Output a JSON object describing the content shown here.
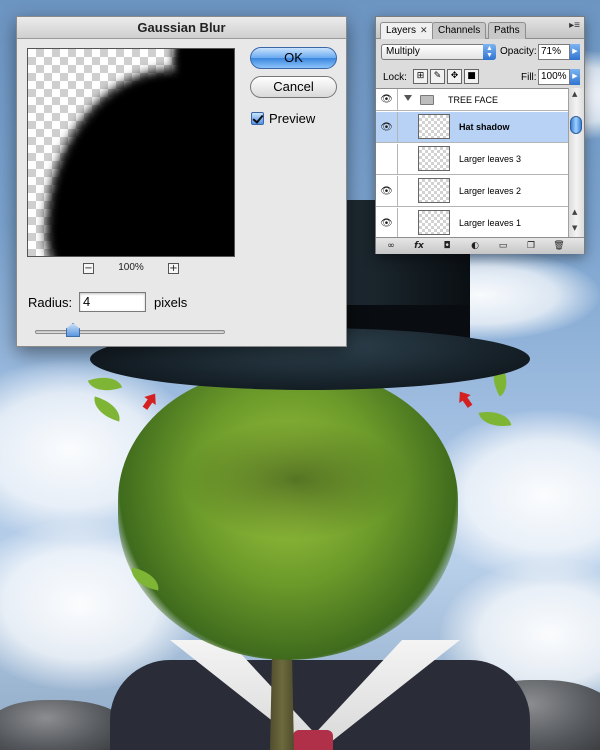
{
  "gaussian_blur": {
    "title": "Gaussian Blur",
    "ok_label": "OK",
    "cancel_label": "Cancel",
    "preview_label": "Preview",
    "preview_checked": true,
    "zoom_out": "−",
    "zoom_in": "+",
    "zoom_level": "100%",
    "radius_label": "Radius:",
    "radius_value": "4",
    "radius_unit": "pixels",
    "radius_slider_fraction": 0.2
  },
  "layers_panel": {
    "tabs": [
      {
        "label": "Layers",
        "active": true,
        "close": "✕"
      },
      {
        "label": "Channels",
        "active": false
      },
      {
        "label": "Paths",
        "active": false
      }
    ],
    "panel_menu": "▸≡",
    "blend_mode": "Multiply",
    "opacity_label": "Opacity:",
    "opacity_value": "71%",
    "lock_label": "Lock:",
    "fill_label": "Fill:",
    "fill_value": "100%",
    "group_name": "TREE FACE",
    "layers": [
      {
        "name": "Hat shadow",
        "selected": true
      },
      {
        "name": "Larger leaves 3",
        "selected": false
      },
      {
        "name": "Larger leaves 2",
        "selected": false
      },
      {
        "name": "Larger leaves 1",
        "selected": false
      }
    ],
    "bottom_icons": [
      "link-icon",
      "fx-icon",
      "mask-icon",
      "adjustment-icon",
      "folder-icon",
      "new-layer-icon",
      "trash-icon"
    ]
  },
  "colors": {
    "ok_button": "#3b86df",
    "selected_layer": "#b8d2f6",
    "sky": "#7aa2cd"
  }
}
